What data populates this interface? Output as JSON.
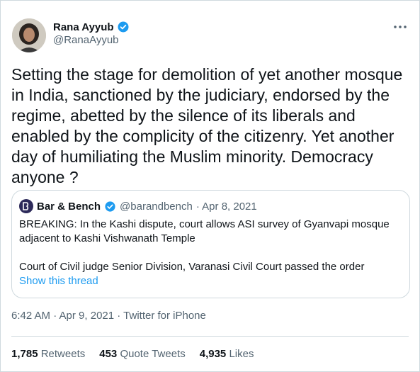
{
  "author": {
    "name": "Rana Ayyub",
    "handle": "@RanaAyyub",
    "avatar_icon": "profile-photo"
  },
  "tweet_text": "Setting the stage for demolition of yet another mosque\nin India, sanctioned by the judiciary, endorsed by the\nregime, abetted by the silence of its liberals and\nenabled by the complicity of the citizenry. Yet another\nday of humiliating the Muslim minority. Democracy\nanyone ?",
  "quoted": {
    "name": "Bar & Bench",
    "handle": "@barandbench",
    "date": "· Apr 8, 2021",
    "line1": "BREAKING: In the Kashi dispute, court allows ASI survey of Gyanvapi mosque adjacent to Kashi Vishwanath Temple",
    "line2": "Court of Civil judge Senior Division, Varanasi Civil Court passed the order",
    "show_thread": "Show this thread"
  },
  "meta": {
    "timestamp": "6:42 AM · Apr 9, 2021 · Twitter for iPhone"
  },
  "stats": [
    {
      "count": "1,785",
      "label": "Retweets"
    },
    {
      "count": "453",
      "label": "Quote Tweets"
    },
    {
      "count": "4,935",
      "label": "Likes"
    }
  ],
  "colors": {
    "accent": "#1d9bf0",
    "text": "#0f1419",
    "secondary": "#536471",
    "border": "#cfd9de"
  }
}
